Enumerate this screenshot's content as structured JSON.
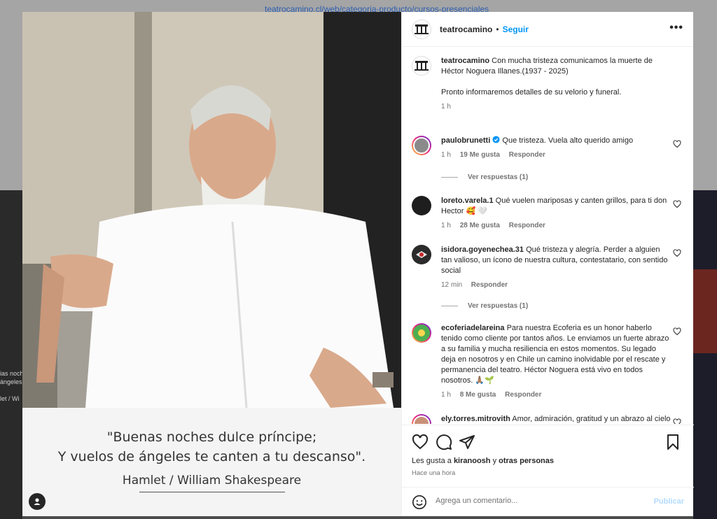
{
  "background": {
    "url_text": "teatrocamino.cl/web/categoria-producto/cursos-presenciales",
    "left_text": "ias noch\nángeles\n\nlet / Wi"
  },
  "post": {
    "quote_line1": "\"Buenas noches dulce príncipe;",
    "quote_line2": "Y vuelos de ángeles te canten a tu descanso\".",
    "attribution": "Hamlet / William Shakespeare",
    "avatar_logo_text": "teatrocamino"
  },
  "header": {
    "username": "teatrocamino",
    "separator": "•",
    "follow_label": "Seguir",
    "more_label": "•••"
  },
  "caption": {
    "username": "teatrocamino",
    "text_line1": "Con mucha tristeza comunicamos la muerte de",
    "text_line2": "Héctor Noguera Illanes.(1937 - 2025)",
    "text_line3": "Pronto informaremos detalles de su velorio y funeral.",
    "time": "1 h"
  },
  "comments": [
    {
      "username": "paulobrunetti",
      "verified": true,
      "text": "Que tristeza. Vuela alto querido amigo",
      "time": "1 h",
      "likes": "19 Me gusta",
      "reply": "Responder",
      "replies_label": "Ver respuestas (1)"
    },
    {
      "username": "loreto.varela.1",
      "text": "Qué vuelen mariposas y canten grillos, para ti don Hector 🥰 🤍",
      "time": "1 h",
      "likes": "28 Me gusta",
      "reply": "Responder"
    },
    {
      "username": "isidora.goyenechea.31",
      "text": "Qué tristeza y alegría. Perder a alguien tan valioso, un ícono de nuestra cultura, contestatario, con sentido social",
      "time": "12 min",
      "reply": "Responder",
      "replies_label": "Ver respuestas (1)"
    },
    {
      "username": "ecoferiadelareina",
      "text": "Para nuestra Ecoferia es un honor haberlo tenido como cliente por tantos años. Le enviamos un fuerte abrazo a su familia y mucha resiliencia en estos momentos. Su legado deja en nosotros y en Chile un camino inolvidable por el rescate y permanencia del teatro. Héctor Noguera está vivo en todos nosotros. 🙏🏽🌱",
      "time": "1 h",
      "likes": "8 Me gusta",
      "reply": "Responder"
    },
    {
      "username": "ely.torres.mitrovith",
      "text": "Amor, admiración, gratitud y un abrazo al cielo 💗 Gracias por tanto maestro"
    }
  ],
  "footer": {
    "likes_prefix": "Les gusta a",
    "likes_user": "kiranoosh",
    "likes_mid": "y",
    "likes_others": "otras personas",
    "time_ago": "Hace una hora",
    "comment_placeholder": "Agrega un comentario...",
    "publish_label": "Publicar"
  },
  "colors": {
    "accent": "#0095f6",
    "publish_disabled": "#b3dbff",
    "like_red": "#ed4956"
  }
}
